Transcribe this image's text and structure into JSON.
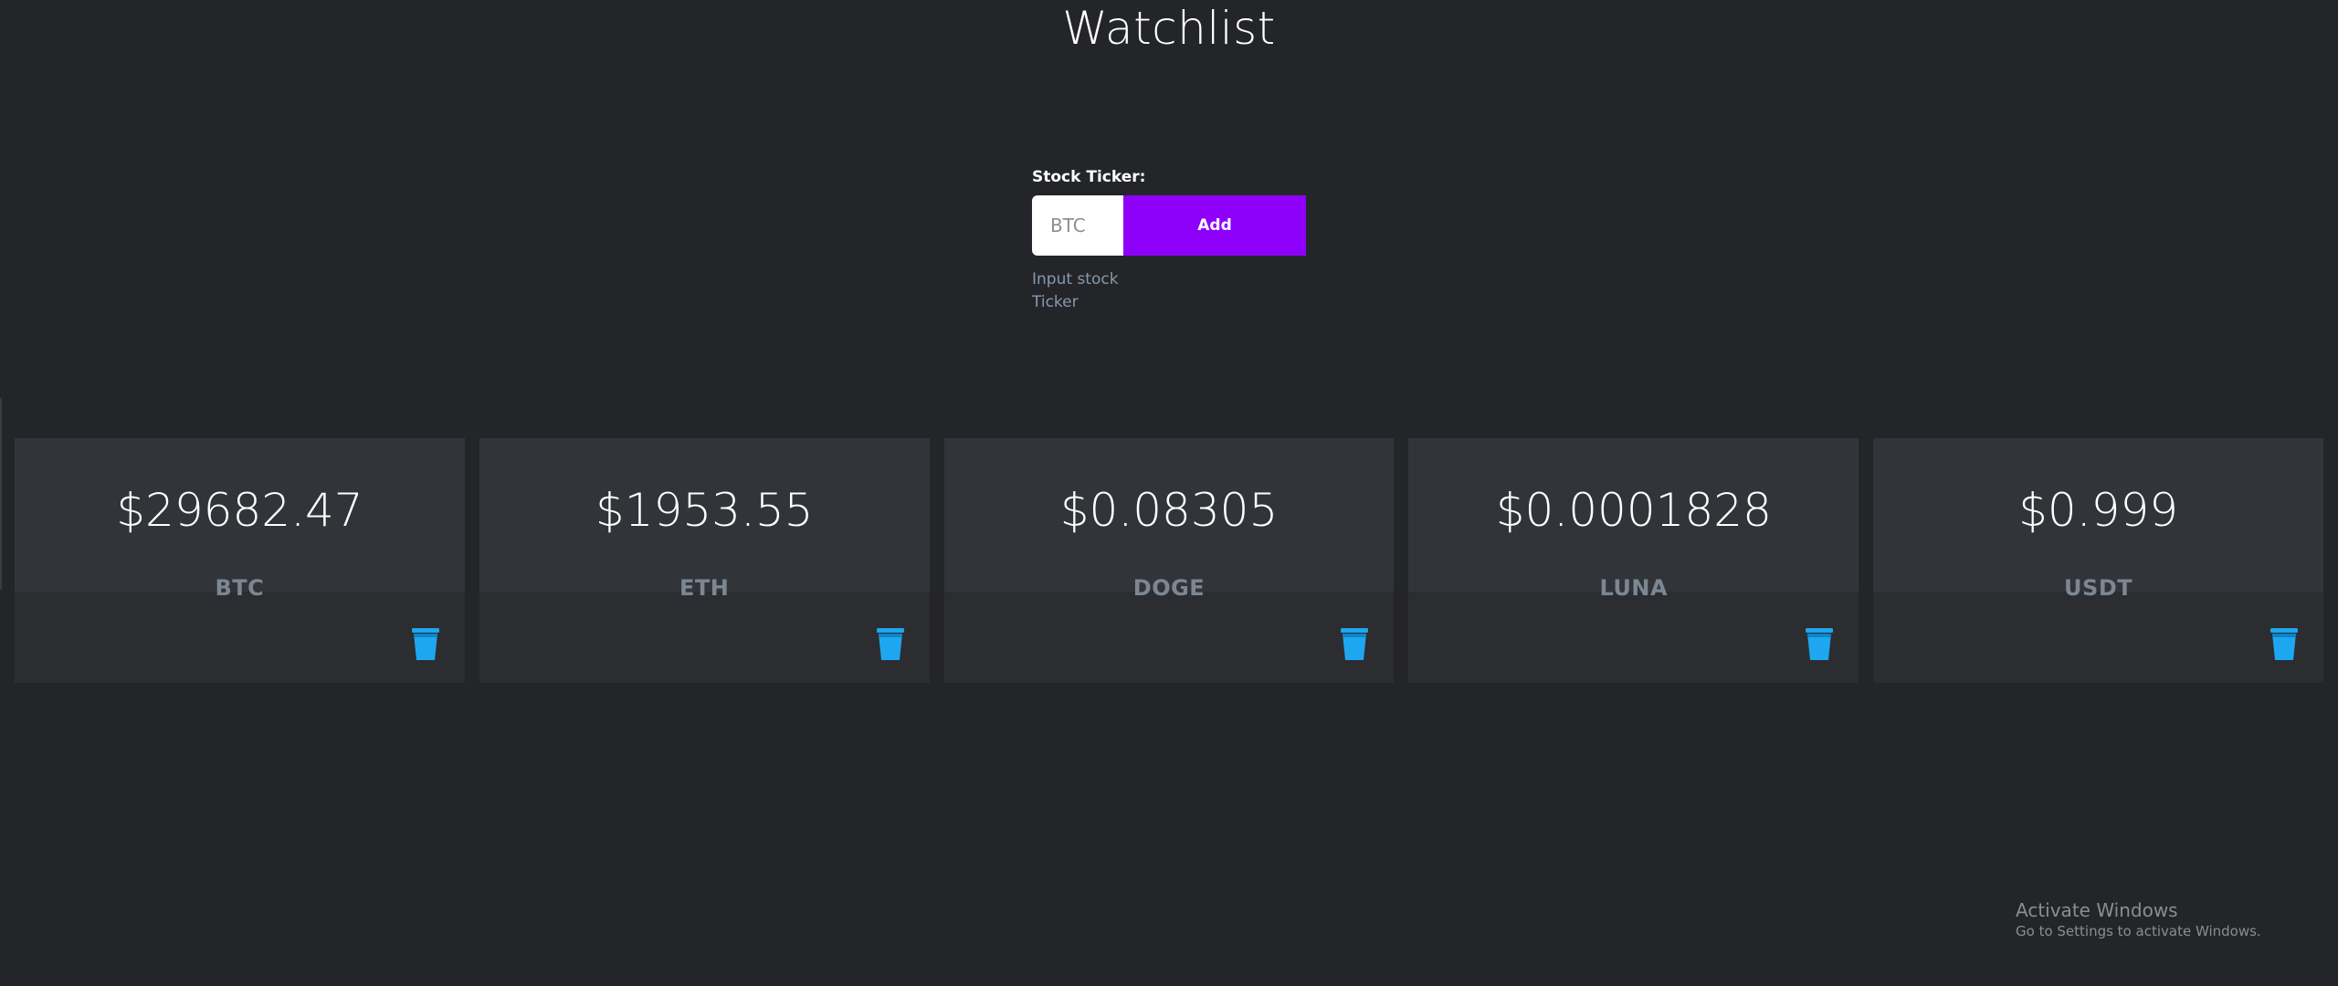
{
  "header": {
    "title": "Watchlist"
  },
  "form": {
    "label": "Stock Ticker:",
    "input_placeholder": "BTC",
    "input_value": "",
    "add_label": "Add",
    "help_text": "Input stock Ticker"
  },
  "cards": [
    {
      "price": "$29682.47",
      "symbol": "BTC",
      "delete_icon": "trash-icon"
    },
    {
      "price": "$1953.55",
      "symbol": "ETH",
      "delete_icon": "trash-icon"
    },
    {
      "price": "$0.08305",
      "symbol": "DOGE",
      "delete_icon": "trash-icon"
    },
    {
      "price": "$0.0001828",
      "symbol": "LUNA",
      "delete_icon": "trash-icon"
    },
    {
      "price": "$0.999",
      "symbol": "USDT",
      "delete_icon": "trash-icon"
    }
  ],
  "colors": {
    "background": "#242528",
    "accent": "#8f00fb",
    "trash": "#1ea7f0",
    "card_top": "#31353a",
    "card_bottom": "#2b2d31"
  },
  "watermark": {
    "title": "Activate Windows",
    "subtitle": "Go to Settings to activate Windows."
  }
}
